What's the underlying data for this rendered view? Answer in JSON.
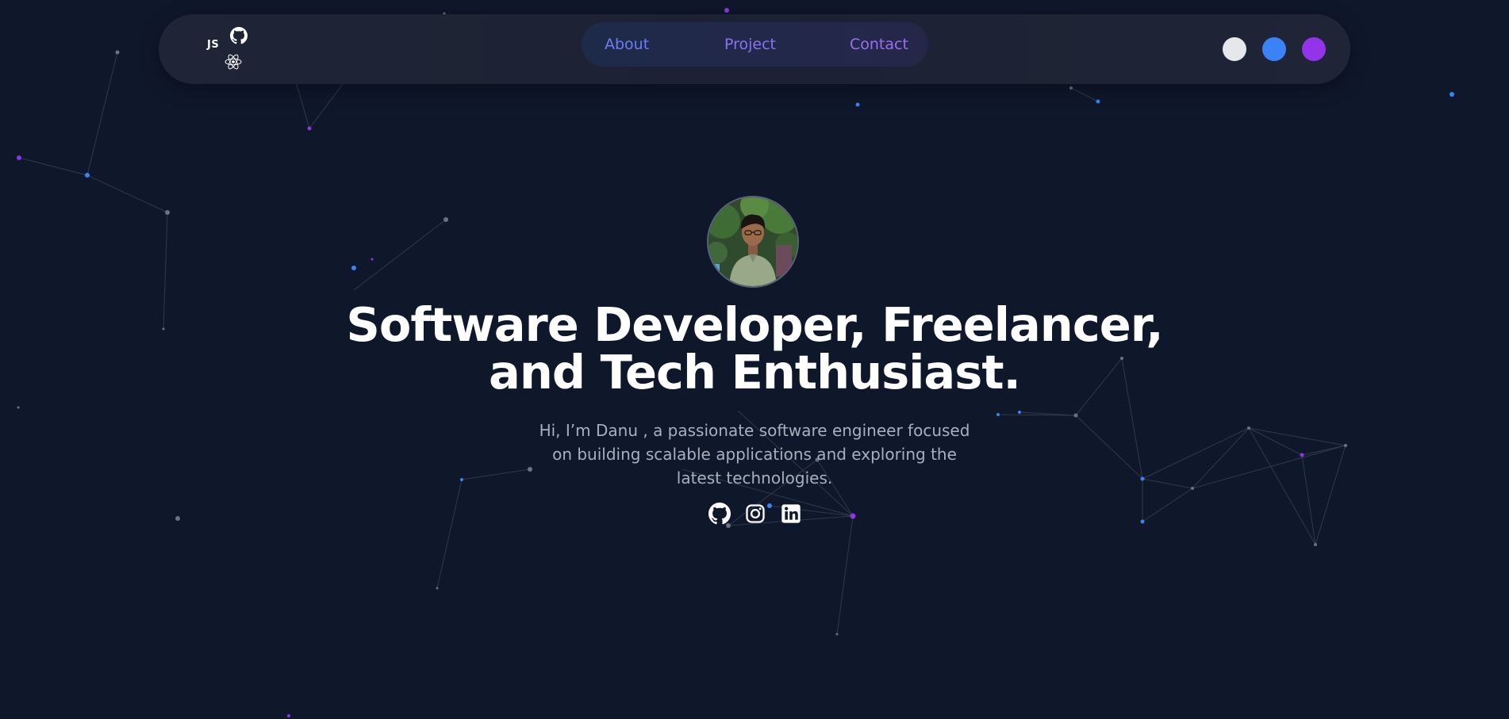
{
  "nav": {
    "logo_text": "JS",
    "links": [
      "About",
      "Project",
      "Contact"
    ]
  },
  "theme_dots": [
    "#e5e7eb",
    "#3b82f6",
    "#9333ea"
  ],
  "hero": {
    "headline_line1": "Software Developer, Freelancer,",
    "headline_line2": "and Tech Enthusiast.",
    "intro": "Hi, I’m Danu , a passionate software engineer focused on building scalable applications and exploring the latest technologies."
  },
  "socials": [
    "github-icon",
    "instagram-icon",
    "linkedin-icon"
  ],
  "colors": {
    "background": "#0f172a",
    "accent_blue": "#3b82f6",
    "accent_purple": "#9333ea"
  }
}
